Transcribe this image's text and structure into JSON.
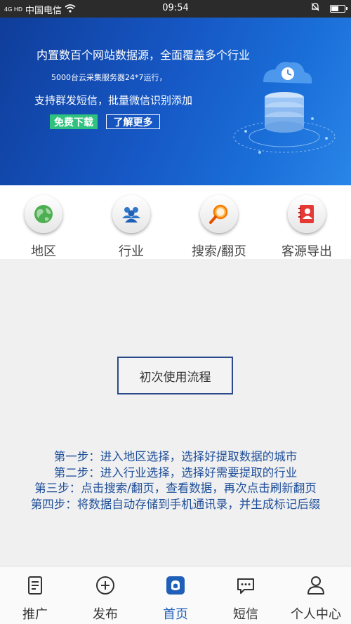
{
  "status_bar": {
    "network": "4G HD",
    "carrier": "中国电信",
    "time": "09:54",
    "battery_level": 0.6
  },
  "banner": {
    "line1": "内置数百个网站数据源，全面覆盖多个行业",
    "line2": "5000台云采集服务器24*7运行，",
    "line3": "支持群发短信，批量微信识别添加",
    "free_download": "免费下载",
    "learn_more": "了解更多",
    "colors": {
      "bg_dark": "#0f3d9a",
      "bg_light": "#2a86e8",
      "free_btn": "#2ec27e"
    }
  },
  "categories": [
    {
      "label": "地区",
      "icon": "globe-icon"
    },
    {
      "label": "行业",
      "icon": "people-icon"
    },
    {
      "label": "搜索/翻页",
      "icon": "search-icon"
    },
    {
      "label": "客源导出",
      "icon": "contacts-book-icon"
    }
  ],
  "main": {
    "flow_button": "初次使用流程",
    "steps": [
      "第一步：进入地区选择，选择好提取数据的城市",
      "第二步：进入行业选择，选择好需要提取的行业",
      "第三步：点击搜索/翻页，查看数据，再次点击刷新翻页",
      "第四步：将数据自动存储到手机通讯录，并生成标记后缀"
    ],
    "step_color": "#1f4f9a"
  },
  "bottom_nav": [
    {
      "label": "推广",
      "icon": "document-icon",
      "active": false
    },
    {
      "label": "发布",
      "icon": "plus-circle-icon",
      "active": false
    },
    {
      "label": "首页",
      "icon": "home-icon",
      "active": true
    },
    {
      "label": "短信",
      "icon": "message-icon",
      "active": false
    },
    {
      "label": "个人中心",
      "icon": "user-icon",
      "active": false
    }
  ],
  "accent_color": "#1f5fb8"
}
